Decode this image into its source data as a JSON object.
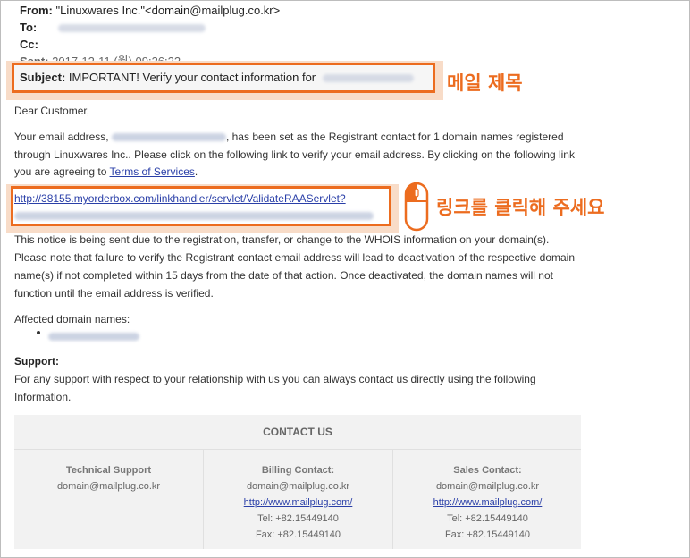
{
  "header": {
    "from_label": "From:",
    "from_value": "\"Linuxwares Inc.\"<domain@mailplug.co.kr>",
    "to_label": "To:",
    "cc_label": "Cc:",
    "sent_label": "Sent:",
    "sent_value": "2017-12-11 (월) 09:36:22",
    "subject_label": "Subject:",
    "subject_value": "IMPORTANT! Verify your contact information for"
  },
  "annotations": {
    "subject_callout": "메일 제목",
    "link_callout": "링크를 클릭해 주세요",
    "accent_color": "#ec6c1f"
  },
  "body": {
    "greeting": "Dear Customer,",
    "p1_a": "Your email address,",
    "p1_b": ", has been set as the Registrant contact for 1 domain names registered",
    "p1_line2": "through Linuxwares Inc.. Please click on the following link to verify your email address. By clicking on the following link",
    "p1_line3_a": "you are agreeing to",
    "terms_link": "Terms of Services",
    "p1_line3_b": ".",
    "verify_link": "http://38155.myorderbox.com/linkhandler/servlet/ValidateRAAServlet?",
    "p2_line1": "This notice is being sent due to the registration, transfer, or change to the WHOIS information on your domain(s).",
    "p2_line2": "Please note that failure to verify the Registrant contact email address will lead to deactivation of the respective domain",
    "p2_line3": "name(s) if not completed within 15 days from the date of that action. Once deactivated, the domain names will not",
    "p2_line4": "function until the email address is verified.",
    "affected_label": "Affected domain names:",
    "support_title": "Support:",
    "support_line1": "For any support with respect to your relationship with us you can always contact us directly using the following",
    "support_line2": "Information."
  },
  "contact": {
    "title": "CONTACT US",
    "columns": [
      {
        "title": "Technical Support",
        "email": "domain@mailplug.co.kr"
      },
      {
        "title": "Billing Contact:",
        "email": "domain@mailplug.co.kr",
        "url": "http://www.mailplug.com/",
        "tel": "Tel: +82.15449140",
        "fax": "Fax: +82.15449140"
      },
      {
        "title": "Sales Contact:",
        "email": "domain@mailplug.co.kr",
        "url": "http://www.mailplug.com/",
        "tel": "Tel: +82.15449140",
        "fax": "Fax: +82.15449140"
      }
    ]
  }
}
